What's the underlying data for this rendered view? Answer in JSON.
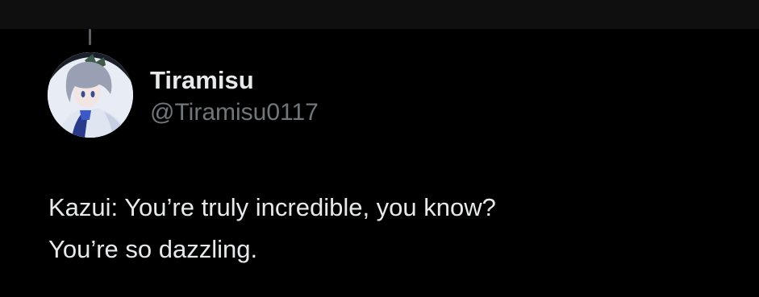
{
  "user": {
    "display_name": "Tiramisu",
    "handle": "@Tiramisu0117",
    "avatar_icon": "avatar-image"
  },
  "post": {
    "lines": [
      "Kazui: You’re truly incredible, you know?",
      "You’re so dazzling."
    ]
  },
  "colors": {
    "background": "#000000",
    "top_bar": "#0f0f0f",
    "primary_text": "#e7e9ea",
    "secondary_text": "#71767b",
    "thread_line": "#5b5f63"
  }
}
